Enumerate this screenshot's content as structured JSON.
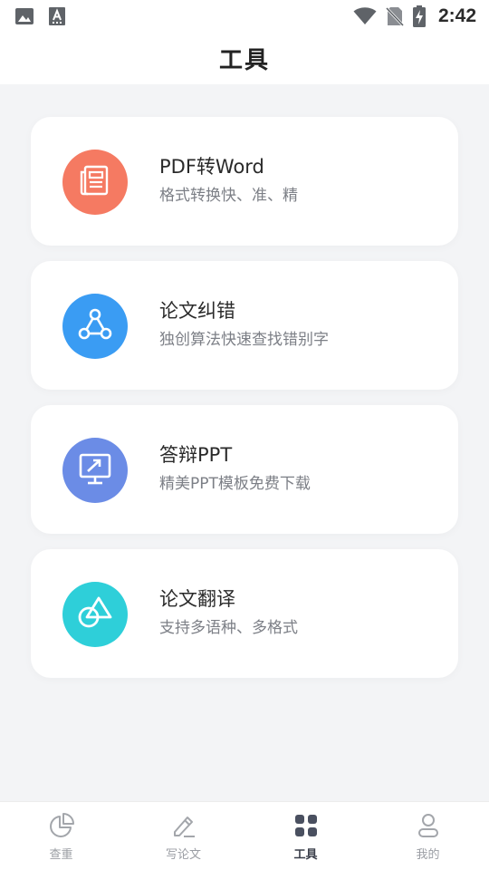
{
  "status_bar": {
    "time": "2:42",
    "icons": [
      "image-icon",
      "keyboard-a-icon",
      "wifi-icon",
      "no-sim-icon",
      "battery-charging-icon"
    ]
  },
  "header": {
    "title": "工具"
  },
  "tools": [
    {
      "title": "PDF转Word",
      "subtitle": "格式转换快、准、精",
      "icon": "document-icon",
      "color": "#f57a62"
    },
    {
      "title": "论文纠错",
      "subtitle": "独创算法快速查找错别字",
      "icon": "nodes-icon",
      "color": "#3a9cf3"
    },
    {
      "title": "答辩PPT",
      "subtitle": "精美PPT模板免费下载",
      "icon": "presentation-icon",
      "color": "#6b8ce6"
    },
    {
      "title": "论文翻译",
      "subtitle": "支持多语种、多格式",
      "icon": "shapes-icon",
      "color": "#2ecfd9"
    }
  ],
  "bottom_nav": [
    {
      "label": "查重",
      "icon": "pie-chart-icon",
      "active": false
    },
    {
      "label": "写论文",
      "icon": "pencil-icon",
      "active": false
    },
    {
      "label": "工具",
      "icon": "grid-icon",
      "active": true
    },
    {
      "label": "我的",
      "icon": "user-icon",
      "active": false
    }
  ],
  "colors": {
    "background": "#f3f4f6",
    "active_nav": "#3a3e4a",
    "inactive_nav": "#9a9da3"
  }
}
